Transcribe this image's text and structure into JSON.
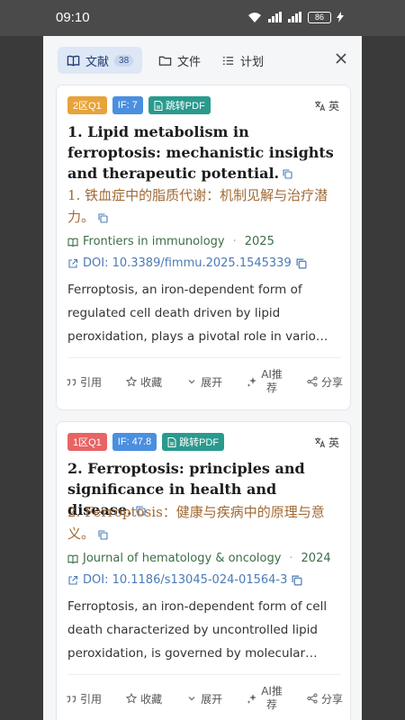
{
  "status": {
    "time": "09:10",
    "battery": "86"
  },
  "tabs": [
    {
      "label": "文献",
      "badge": "38",
      "icon": "book-icon"
    },
    {
      "label": "文件",
      "icon": "folder-icon"
    },
    {
      "label": "计划",
      "icon": "list-icon"
    }
  ],
  "lang_label": "英",
  "actions": {
    "cite": "引用",
    "favorite": "收藏",
    "expand": "展开",
    "ai_1": "AI推",
    "ai_2": "荐",
    "share": "分享"
  },
  "cards": [
    {
      "zone": "2区Q1",
      "if": "IF: 7",
      "pdf": "跳转PDF",
      "title_en": "1. Lipid metabolism in ferroptosis: mechanistic insights and therapeutic potential.",
      "title_cn": "1. 铁血症中的脂质代谢：机制见解与治疗潜力。",
      "journal": "Frontiers in immunology",
      "year": "2025",
      "doi": "DOI: 10.3389/fimmu.2025.1545339",
      "abstract": "Ferroptosis, an iron-dependent form of regulated cell death driven by lipid peroxidation, plays a pivotal role in vario…"
    },
    {
      "zone": "1区Q1",
      "if": "IF: 47.8",
      "pdf": "跳转PDF",
      "title_en": "2. Ferroptosis: principles and significance in health and disease.",
      "title_cn": "2. Ferroptosis：健康与疾病中的原理与意义。",
      "journal": "Journal of hematology & oncology",
      "year": "2024",
      "doi": "DOI: 10.1186/s13045-024-01564-3",
      "abstract": "Ferroptosis, an iron-dependent form of cell death characterized by uncontrolled lipid peroxidation, is governed by molecular…"
    }
  ],
  "colors": {
    "zone2": "#e8a33a",
    "zone1": "#e86464",
    "if": "#4a8fe0",
    "pdf": "#2a9a8e",
    "journal": "#3d6e46",
    "doi": "#4a7ab8",
    "title_cn": "#a06a33"
  }
}
